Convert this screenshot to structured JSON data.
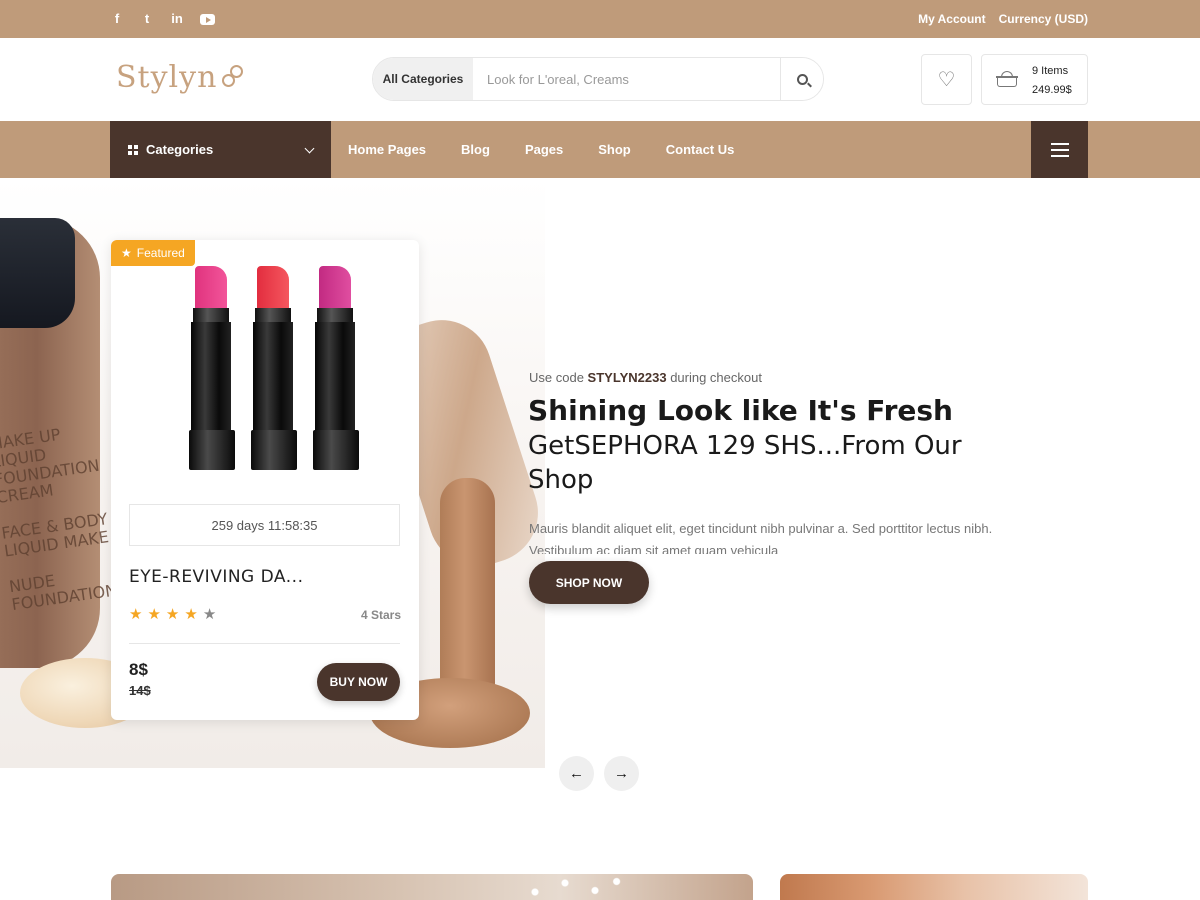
{
  "topbar": {
    "social_icons": [
      "facebook-icon",
      "twitter-icon",
      "linkedin-icon",
      "youtube-icon"
    ],
    "social_glyphs": {
      "facebook": "f",
      "twitter": "t",
      "linkedin": "in"
    },
    "my_account": "My Account",
    "currency": "Currency (USD)",
    "bg_color": "#bf9b7a"
  },
  "header": {
    "logo_text": "Stylyn",
    "search": {
      "category": "All Categories",
      "placeholder": "Look for L'oreal, Creams"
    },
    "wishlist_icon": "heart-icon",
    "cart": {
      "icon": "basket-icon",
      "items": "9 Items",
      "total": "249.99$"
    }
  },
  "nav": {
    "categories_label": "Categories",
    "items": [
      "Home Pages",
      "Blog",
      "Pages",
      "Shop",
      "Contact Us"
    ],
    "dark_color": "#4a352c"
  },
  "product_card": {
    "badge": "Featured",
    "countdown": "259 days 11:58:35",
    "title": "EYE-REVIVING DA...",
    "rating": 4,
    "rating_max": 5,
    "rating_label": "4 Stars",
    "price": "8$",
    "old_price": "14$",
    "buy_label": "BUY NOW",
    "accent_color": "#f5a623"
  },
  "hero": {
    "promo_prefix": "Use code",
    "promo_code": "STYLYN2233",
    "promo_suffix": "during checkout",
    "title": "Shining Look like It's Fresh",
    "subtitle": "GetSEPHORA 129 SHS...From Our Shop",
    "description": "Mauris blandit aliquet elit, eget tincidunt nibh pulvinar a. Sed porttitor lectus nibh. Vestibulum ac diam sit amet quam vehicula",
    "cta": "SHOP NOW",
    "jar_label": "MAKE UP\nLIQUID\nFOUNDATION\nCREAM\n\nFACE & BODY\nLIQUID MAKE UP\n\nNUDE\nFOUNDATION"
  },
  "slider": {
    "prev": "←",
    "next": "→"
  }
}
